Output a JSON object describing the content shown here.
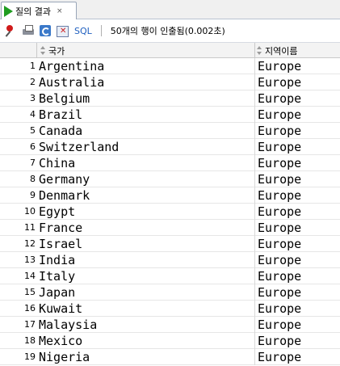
{
  "tab": {
    "label": "질의 결과",
    "close": "×"
  },
  "toolbar": {
    "sql_label": "SQL",
    "status": "50개의 행이 인출됨(0.002초)"
  },
  "columns": {
    "country": "국가",
    "region": "지역이름"
  },
  "rows": [
    {
      "num": "1",
      "country": "Argentina",
      "region": "Europe"
    },
    {
      "num": "2",
      "country": "Australia",
      "region": "Europe"
    },
    {
      "num": "3",
      "country": "Belgium",
      "region": "Europe"
    },
    {
      "num": "4",
      "country": "Brazil",
      "region": "Europe"
    },
    {
      "num": "5",
      "country": "Canada",
      "region": "Europe"
    },
    {
      "num": "6",
      "country": "Switzerland",
      "region": "Europe"
    },
    {
      "num": "7",
      "country": "China",
      "region": "Europe"
    },
    {
      "num": "8",
      "country": "Germany",
      "region": "Europe"
    },
    {
      "num": "9",
      "country": "Denmark",
      "region": "Europe"
    },
    {
      "num": "10",
      "country": "Egypt",
      "region": "Europe"
    },
    {
      "num": "11",
      "country": "France",
      "region": "Europe"
    },
    {
      "num": "12",
      "country": "Israel",
      "region": "Europe"
    },
    {
      "num": "13",
      "country": "India",
      "region": "Europe"
    },
    {
      "num": "14",
      "country": "Italy",
      "region": "Europe"
    },
    {
      "num": "15",
      "country": "Japan",
      "region": "Europe"
    },
    {
      "num": "16",
      "country": "Kuwait",
      "region": "Europe"
    },
    {
      "num": "17",
      "country": "Malaysia",
      "region": "Europe"
    },
    {
      "num": "18",
      "country": "Mexico",
      "region": "Europe"
    },
    {
      "num": "19",
      "country": "Nigeria",
      "region": "Europe"
    }
  ]
}
